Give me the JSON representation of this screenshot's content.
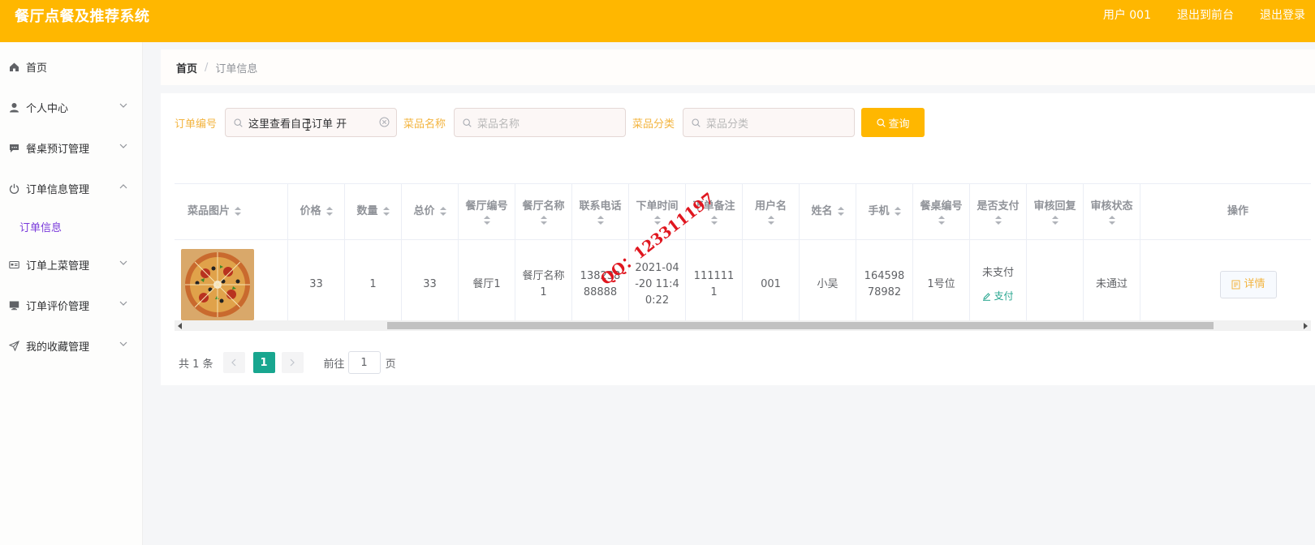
{
  "header": {
    "title": "餐厅点餐及推荐系统",
    "user": "用户 001",
    "back_front": "退出到前台",
    "logout": "退出登录"
  },
  "sidebar": {
    "items": [
      {
        "label": "首页",
        "icon": "home-icon"
      },
      {
        "label": "个人中心",
        "icon": "user-icon"
      },
      {
        "label": "餐桌预订管理",
        "icon": "chat-icon"
      },
      {
        "label": "订单信息管理",
        "icon": "power-icon",
        "expanded": true,
        "children": [
          {
            "label": "订单信息"
          }
        ]
      },
      {
        "label": "订单上菜管理",
        "icon": "card-icon"
      },
      {
        "label": "订单评价管理",
        "icon": "monitor-icon"
      },
      {
        "label": "我的收藏管理",
        "icon": "send-icon"
      }
    ]
  },
  "breadcrumb": {
    "home": "首页",
    "separator": "/",
    "current": "订单信息"
  },
  "search": {
    "order_no_label": "订单编号",
    "order_no_value": "这里查看自己订单 开",
    "dish_name_label": "菜品名称",
    "dish_name_placeholder": "菜品名称",
    "dish_cat_label": "菜品分类",
    "dish_cat_placeholder": "菜品分类",
    "query_button": "查询"
  },
  "table": {
    "columns": [
      "菜品图片",
      "价格",
      "数量",
      "总价",
      "餐厅编号",
      "餐厅名称",
      "联系电话",
      "下单时间",
      "下单备注",
      "用户名",
      "姓名",
      "手机",
      "餐桌编号",
      "是否支付",
      "审核回复",
      "审核状态",
      "操作"
    ],
    "rows": [
      {
        "image": "pizza",
        "price": "33",
        "quantity": "1",
        "total": "33",
        "restaurant_no": "餐厅1",
        "restaurant_name": "餐厅名称1",
        "phone": "13823888888",
        "order_time": "2021-04-20 11:40:22",
        "remark": "1111111",
        "username": "001",
        "name": "小吴",
        "mobile": "16459878982",
        "table_no": "1号位",
        "paid": "未支付",
        "pay_action": "支付",
        "review_reply": "",
        "review_status": "未通过",
        "detail_action": "详情"
      }
    ]
  },
  "pagination": {
    "total": "共 1 条",
    "current": "1",
    "goto_label": "前往",
    "goto_value": "1",
    "page_suffix": "页"
  },
  "watermark": "QQ：123311197",
  "colors": {
    "header": "#ffb700",
    "accent": "#ffb700",
    "active_page": "#18a68f",
    "label": "#f3b43f"
  }
}
